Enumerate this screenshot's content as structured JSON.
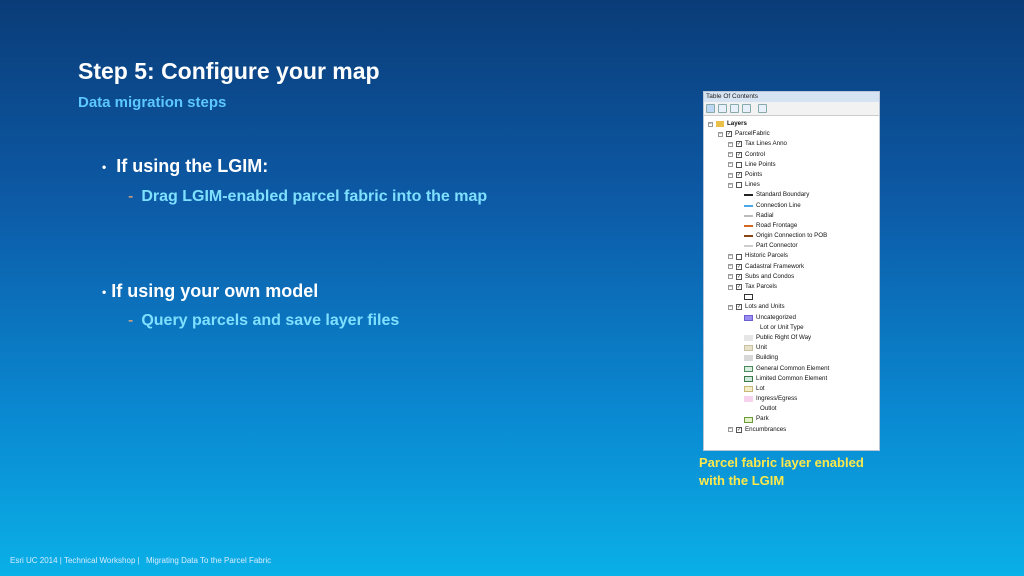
{
  "slide": {
    "title": "Step 5: Configure your map",
    "subtitle": "Data migration steps",
    "bullets": [
      {
        "marker": "•",
        "text": "If using the LGIM:",
        "sub_marker": "-",
        "sub": "Drag LGIM-enabled parcel fabric into the map"
      },
      {
        "marker": "•",
        "text": "If using your own model",
        "sub_marker": "-",
        "sub": "Query parcels and save layer files"
      }
    ],
    "caption": [
      "Parcel fabric layer enabled",
      "with the LGIM"
    ],
    "footer": [
      "Esri UC 2014 | Technical Workshop |",
      "Migrating Data To the Parcel Fabric"
    ]
  },
  "toc": {
    "title": "Table Of Contents",
    "rows": [
      {
        "label": "Layers",
        "kind": "folder",
        "indent": 0,
        "bold": true
      },
      {
        "label": "ParcelFabric",
        "kind": "check",
        "indent": 1,
        "checked": true
      },
      {
        "label": "Tax Lines Anno",
        "kind": "check",
        "indent": 2,
        "checked": true
      },
      {
        "label": "Control",
        "kind": "check",
        "indent": 2,
        "checked": true
      },
      {
        "label": "Line Points",
        "kind": "check",
        "indent": 2,
        "checked": false
      },
      {
        "label": "Points",
        "kind": "check",
        "indent": 2,
        "checked": true
      },
      {
        "label": "Lines",
        "kind": "check",
        "indent": 2,
        "checked": false
      },
      {
        "label": "Standard Boundary",
        "kind": "line",
        "indent": 3,
        "color": "#222222"
      },
      {
        "label": "Connection Line",
        "kind": "line",
        "indent": 3,
        "color": "#4aa8e8"
      },
      {
        "label": "Radial",
        "kind": "line",
        "indent": 3,
        "color": "#bbbbbb"
      },
      {
        "label": "Road Frontage",
        "kind": "line",
        "indent": 3,
        "color": "#d2691e"
      },
      {
        "label": "Origin Connection to POB",
        "kind": "line",
        "indent": 3,
        "color": "#8b4513"
      },
      {
        "label": "Part Connector",
        "kind": "line",
        "indent": 3,
        "color": "#cccccc"
      },
      {
        "label": "Historic Parcels",
        "kind": "check",
        "indent": 2,
        "checked": false
      },
      {
        "label": "Cadastral Framework",
        "kind": "check",
        "indent": 2,
        "checked": true
      },
      {
        "label": "Subs and Condos",
        "kind": "check",
        "indent": 2,
        "checked": true
      },
      {
        "label": "Tax Parcels",
        "kind": "check",
        "indent": 2,
        "checked": true
      },
      {
        "label": "",
        "kind": "box",
        "indent": 3,
        "fill": "#ffffff",
        "border": "#333333"
      },
      {
        "label": "Lots and Units",
        "kind": "check",
        "indent": 2,
        "checked": true
      },
      {
        "label": "Uncategorized",
        "kind": "box",
        "indent": 3,
        "fill": "#9a8cf0",
        "border": "#6b5fd0"
      },
      {
        "label": "Lot or Unit Type",
        "kind": "text",
        "indent": 4
      },
      {
        "label": "Public Right Of Way",
        "kind": "box",
        "indent": 3,
        "fill": "#e6e6e6",
        "border": "#e6e6e6"
      },
      {
        "label": "Unit",
        "kind": "box",
        "indent": 3,
        "fill": "#e8e2c8",
        "border": "#c8c0a0"
      },
      {
        "label": "Building",
        "kind": "box",
        "indent": 3,
        "fill": "#d8d8d8",
        "border": "#d8d8d8"
      },
      {
        "label": "General Common Element",
        "kind": "box",
        "indent": 3,
        "fill": "#d8eee0",
        "border": "#4a8a5a"
      },
      {
        "label": "Limited Common Element",
        "kind": "box",
        "indent": 3,
        "fill": "#cfe8dc",
        "border": "#3a7a4a"
      },
      {
        "label": "Lot",
        "kind": "box",
        "indent": 3,
        "fill": "#f4eec8",
        "border": "#c8b878"
      },
      {
        "label": "Ingress/Egress",
        "kind": "box",
        "indent": 3,
        "fill": "#f6d2ec",
        "border": "#f6d2ec"
      },
      {
        "label": "Outlot",
        "kind": "text",
        "indent": 4
      },
      {
        "label": "Park",
        "kind": "box",
        "indent": 3,
        "fill": "#e4f2c8",
        "border": "#6a9a3a"
      },
      {
        "label": "Encumbrances",
        "kind": "check",
        "indent": 2,
        "checked": true
      }
    ]
  }
}
